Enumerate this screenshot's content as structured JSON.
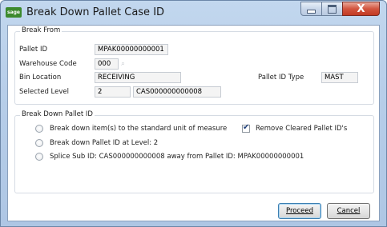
{
  "window": {
    "title": "Break Down Pallet Case ID",
    "app_icon_text": "sage",
    "close_glyph": "X"
  },
  "break_from": {
    "group_title": "Break From",
    "pallet_id_label": "Pallet ID",
    "pallet_id_value": "MPAK00000000001",
    "warehouse_code_label": "Warehouse Code",
    "warehouse_code_value": "000",
    "bin_location_label": "Bin Location",
    "bin_location_value": "RECEIVING",
    "selected_level_label": "Selected Level",
    "selected_level_value": "2",
    "selected_case_value": "CAS000000000008",
    "pallet_id_type_label": "Pallet ID Type",
    "pallet_id_type_value": "MAST"
  },
  "break_down": {
    "group_title": "Break Down Pallet ID",
    "option1": "Break down item(s) to the standard unit of measure",
    "option2": "Break down Pallet ID at Level: 2",
    "option3": "Splice Sub ID: CAS000000000008 away from Pallet ID: MPAK00000000001",
    "remove_cleared_label": "Remove Cleared Pallet ID's",
    "remove_cleared_checked": true
  },
  "buttons": {
    "proceed": "Proceed",
    "cancel": "Cancel"
  },
  "colors": {
    "accent_border": "#3c7fb1",
    "close_button": "#c23a23",
    "frame": "#b7cee9"
  }
}
